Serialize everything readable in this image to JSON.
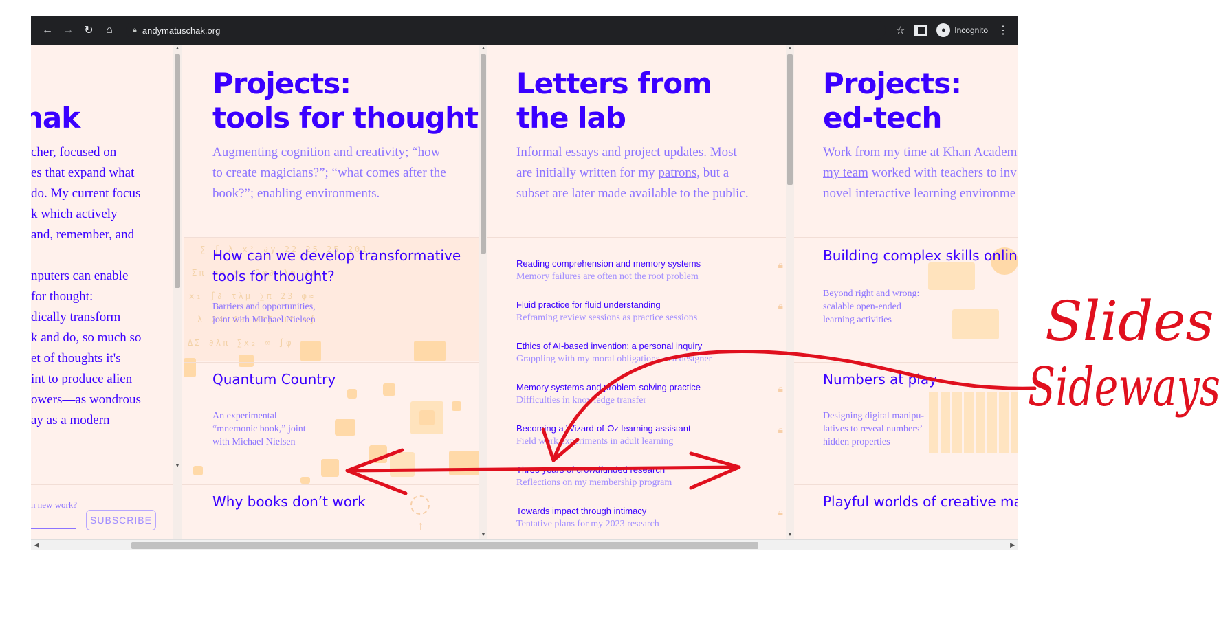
{
  "browser": {
    "url": "andymatuschak.org",
    "profile_label": "Incognito",
    "icons": [
      "back-icon",
      "forward-icon",
      "reload-icon",
      "home-icon",
      "lock-icon",
      "star-icon",
      "side-panel-icon",
      "incognito-icon",
      "menu-icon"
    ]
  },
  "pane_intro": {
    "title_fragment": "hak",
    "lines": [
      "cher, focused on",
      "es that expand what",
      "do. My current focus",
      "k which actively",
      "and, remember, and",
      "",
      "nputers can enable",
      "for thought:",
      "dically transform",
      "k and do, so much so",
      "et of thoughts it's",
      "int to produce alien",
      "owers—as wondrous",
      "ay as a modern"
    ],
    "signup_prompt": "n new work?",
    "subscribe_label": "SUBSCRIBE"
  },
  "pane_tools": {
    "title_line1": "Projects:",
    "title_line2": "tools for thought",
    "desc_line1": "Augmenting cognition and creativity; “how",
    "desc_line2": "to create magicians?”; “what comes after the",
    "desc_line3": "book?”; enabling environments.",
    "cards": [
      {
        "title_line1": "How can we develop transformative",
        "title_line2": "tools for thought?",
        "sub_line1": "Barriers and opportunities,",
        "sub_line2": "joint with Michael Nielsen",
        "sub_line3": ""
      },
      {
        "title_line1": "Quantum Country",
        "title_line2": "",
        "sub_line1": "An experimental",
        "sub_line2": "“mnemonic book,” joint",
        "sub_line3": "with Michael Nielsen"
      },
      {
        "title_line1": "Why books don’t work",
        "title_line2": "",
        "sub_line1": "",
        "sub_line2": "",
        "sub_line3": ""
      }
    ]
  },
  "pane_letters": {
    "title_line1": "Letters from",
    "title_line2": "the lab",
    "desc_line1": "Informal essays and project updates. Most",
    "desc_line2_a": "are initially written for my ",
    "desc_line2_link": "patrons",
    "desc_line2_b": ", but a",
    "desc_line3": "subset are later made available to the public.",
    "letters": [
      {
        "title": "Reading comprehension and memory systems",
        "sub": "Memory failures are often not the root problem",
        "locked": true
      },
      {
        "title": "Fluid practice for fluid understanding",
        "sub": "Reframing review sessions as practice sessions",
        "locked": true
      },
      {
        "title": "Ethics of AI-based invention: a personal inquiry",
        "sub": "Grappling with my moral obligations as a designer",
        "locked": false
      },
      {
        "title": "Memory systems and problem-solving practice",
        "sub": "Difficulties in knowledge transfer",
        "locked": true
      },
      {
        "title": "Becoming a Wizard-of-Oz learning assistant",
        "sub": "Field work experiments in adult learning",
        "locked": true
      },
      {
        "title": "Three years of crowdfunded research",
        "sub": "Reflections on my membership program",
        "locked": false
      },
      {
        "title": "Towards impact through intimacy",
        "sub": "Tentative plans for my 2023 research",
        "locked": true
      }
    ]
  },
  "pane_edtech": {
    "title_line1": "Projects:",
    "title_line2": "ed-tech",
    "desc_line1_a": "Work from my time at ",
    "desc_line1_link": "Khan Academ",
    "desc_line2_link": "my team",
    "desc_line2_b": " worked with teachers to inv",
    "desc_line3": "novel interactive learning environme",
    "cards": [
      {
        "title": "Building complex skills online",
        "sub_line1": "Beyond right and wrong:",
        "sub_line2": "scalable open-ended",
        "sub_line3": "learning activities"
      },
      {
        "title": "Numbers at play",
        "sub_line1": "Designing digital manipu-",
        "sub_line2": "latives to reveal numbers’",
        "sub_line3": "hidden properties"
      },
      {
        "title": "Playful worlds of creative mat",
        "sub_line1": "",
        "sub_line2": "",
        "sub_line3": ""
      }
    ]
  },
  "annotation": {
    "line1": "Slides",
    "line2": "Sideways",
    "color": "#e0101e"
  },
  "colors": {
    "accent": "#3a00ff",
    "muted": "#8d74ff",
    "page_bg": "#fff1ec",
    "decor": "#ffd9a8"
  }
}
